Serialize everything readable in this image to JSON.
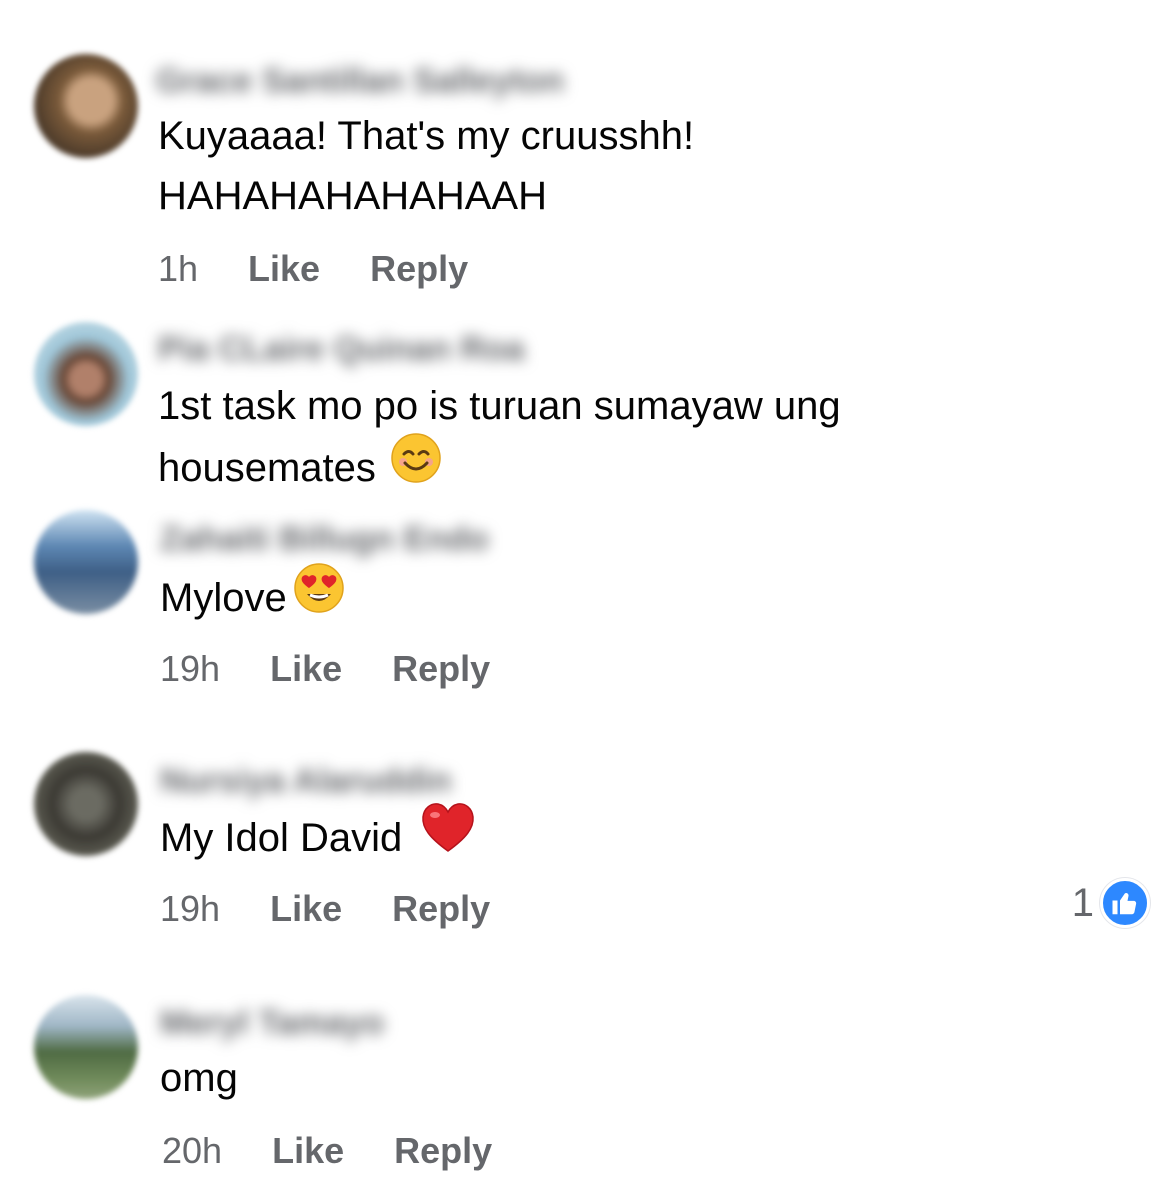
{
  "comments": [
    {
      "author": "Grace Santillan Salleyton",
      "lines": [
        "Kuyaaaa! That's my cruusshh!",
        "HAHAHAHAHAHAAH"
      ],
      "emoji": "",
      "time": "1h",
      "like_label": "Like",
      "reply_label": "Reply"
    },
    {
      "author": "Pia CLaire Quinan Roa",
      "lines": [
        "1st task mo po is turuan sumayaw ung",
        "housemates"
      ],
      "emoji": "smiling-face-icon",
      "time": "",
      "like_label": "",
      "reply_label": ""
    },
    {
      "author": "Zahaiti Billugn Endo",
      "lines": [
        "Mylove"
      ],
      "emoji": "heart-eyes-icon",
      "time": "19h",
      "like_label": "Like",
      "reply_label": "Reply"
    },
    {
      "author": "Nursiya Alaruddin",
      "lines": [
        "My Idol David"
      ],
      "emoji": "red-heart-icon",
      "time": "19h",
      "like_label": "Like",
      "reply_label": "Reply",
      "reaction_count": "1"
    },
    {
      "author": "Meryl Tamayo",
      "lines": [
        "omg"
      ],
      "emoji": "",
      "time": "20h",
      "like_label": "Like",
      "reply_label": "Reply"
    }
  ],
  "colors": {
    "text": "#050505",
    "meta": "#65676b",
    "like_badge": "#2d88ff",
    "heart": "#e0242a",
    "emoji_yellow": "#fbc531"
  }
}
